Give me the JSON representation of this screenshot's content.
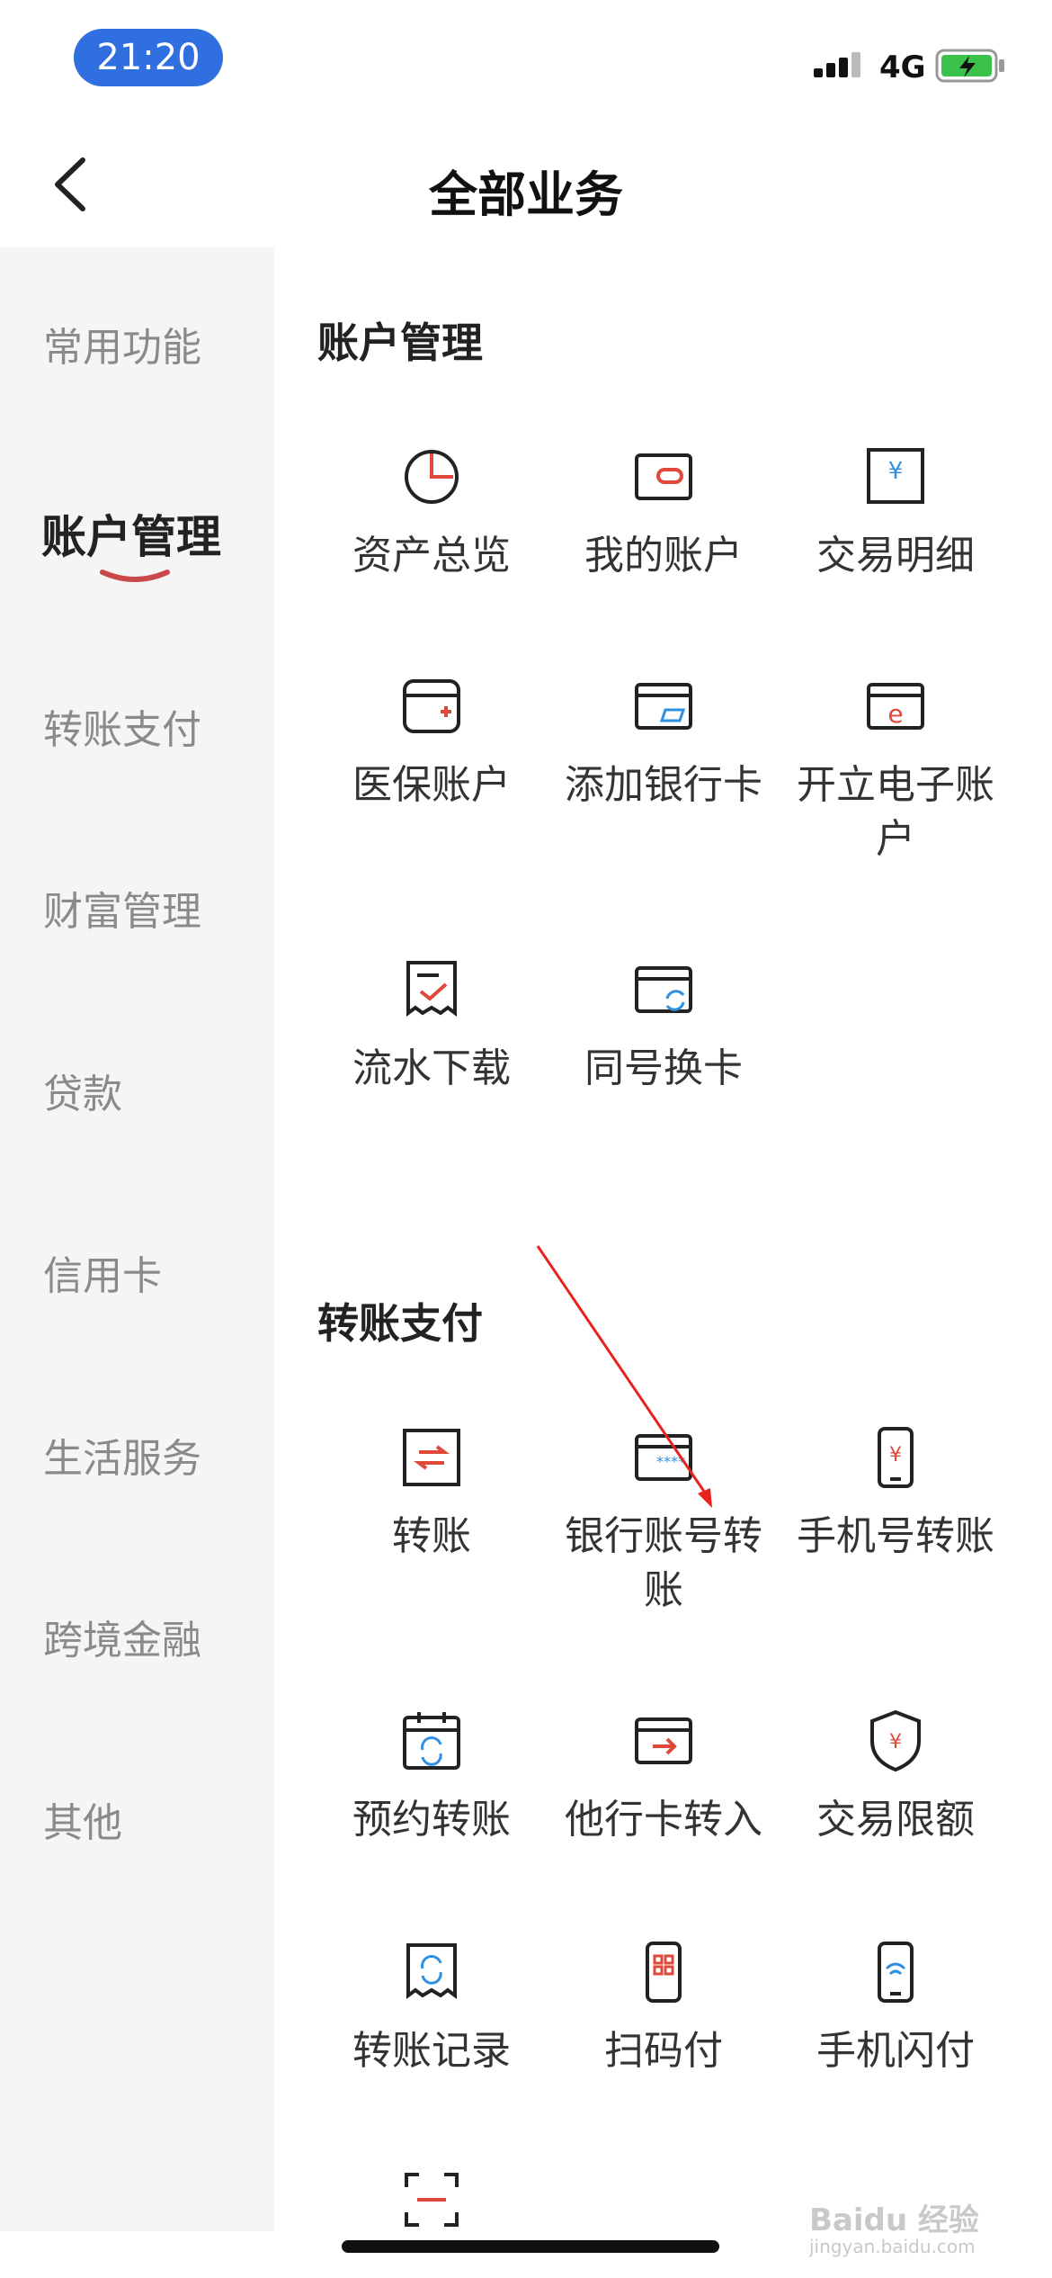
{
  "status": {
    "time": "21:20",
    "network": "4G"
  },
  "header": {
    "title": "全部业务"
  },
  "sidebar": {
    "items": [
      {
        "label": "常用功能"
      },
      {
        "label": "账户管理"
      },
      {
        "label": "转账支付"
      },
      {
        "label": "财富管理"
      },
      {
        "label": "贷款"
      },
      {
        "label": "信用卡"
      },
      {
        "label": "生活服务"
      },
      {
        "label": "跨境金融"
      },
      {
        "label": "其他"
      }
    ],
    "active_label": "账户管理"
  },
  "sections": [
    {
      "title": "账户管理",
      "tiles": [
        {
          "label": "资产总览",
          "icon": "clock-pie-icon"
        },
        {
          "label": "我的账户",
          "icon": "wallet-icon"
        },
        {
          "label": "交易明细",
          "icon": "yuan-receipt-icon"
        },
        {
          "label": "医保账户",
          "icon": "medical-card-icon"
        },
        {
          "label": "添加银行卡",
          "icon": "add-card-icon"
        },
        {
          "label": "开立电子账户",
          "icon": "e-account-icon"
        },
        {
          "label": "流水下载",
          "icon": "statement-download-icon"
        },
        {
          "label": "同号换卡",
          "icon": "card-swap-icon"
        }
      ]
    },
    {
      "title": "转账支付",
      "tiles": [
        {
          "label": "转账",
          "icon": "transfer-icon"
        },
        {
          "label": "银行账号转账",
          "icon": "bank-card-icon"
        },
        {
          "label": "手机号转账",
          "icon": "phone-yuan-icon"
        },
        {
          "label": "预约转账",
          "icon": "calendar-refresh-icon"
        },
        {
          "label": "他行卡转入",
          "icon": "card-in-icon"
        },
        {
          "label": "交易限额",
          "icon": "shield-yuan-icon"
        },
        {
          "label": "转账记录",
          "icon": "record-icon"
        },
        {
          "label": "扫码付",
          "icon": "qr-phone-icon"
        },
        {
          "label": "手机闪付",
          "icon": "nfc-phone-icon"
        }
      ]
    }
  ],
  "colors": {
    "accent": "#e0483c",
    "brand_blue": "#2f6fe0",
    "sidebar_bg": "#f5f5f5",
    "inactive_text": "#8a8a8a"
  },
  "watermark": {
    "line1": "Baidu 经验",
    "line2": "jingyan.baidu.com"
  }
}
